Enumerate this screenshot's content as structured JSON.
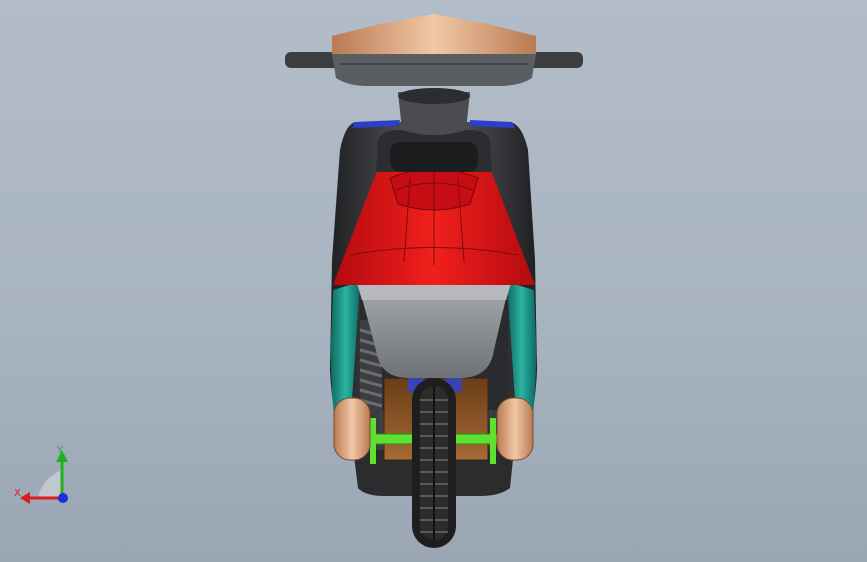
{
  "viewport": {
    "background_top": "#b3bdc9",
    "background_bottom": "#9aa6b4"
  },
  "model": {
    "colors": {
      "body_dark": "#3b3d40",
      "tail_red": "#e0121a",
      "side_teal": "#1f9c8f",
      "tan": "#e8b48c",
      "axle_green": "#5de030",
      "tire": "#1e1e1e",
      "brown": "#8a5628",
      "blue_trim": "#2b3fc8",
      "gray_panel": "#8a8d91"
    }
  },
  "triad": {
    "x_label": "X",
    "y_label": "Y",
    "x_color": "#d81e1e",
    "y_color": "#22b022",
    "z_color": "#1e2fd8"
  }
}
